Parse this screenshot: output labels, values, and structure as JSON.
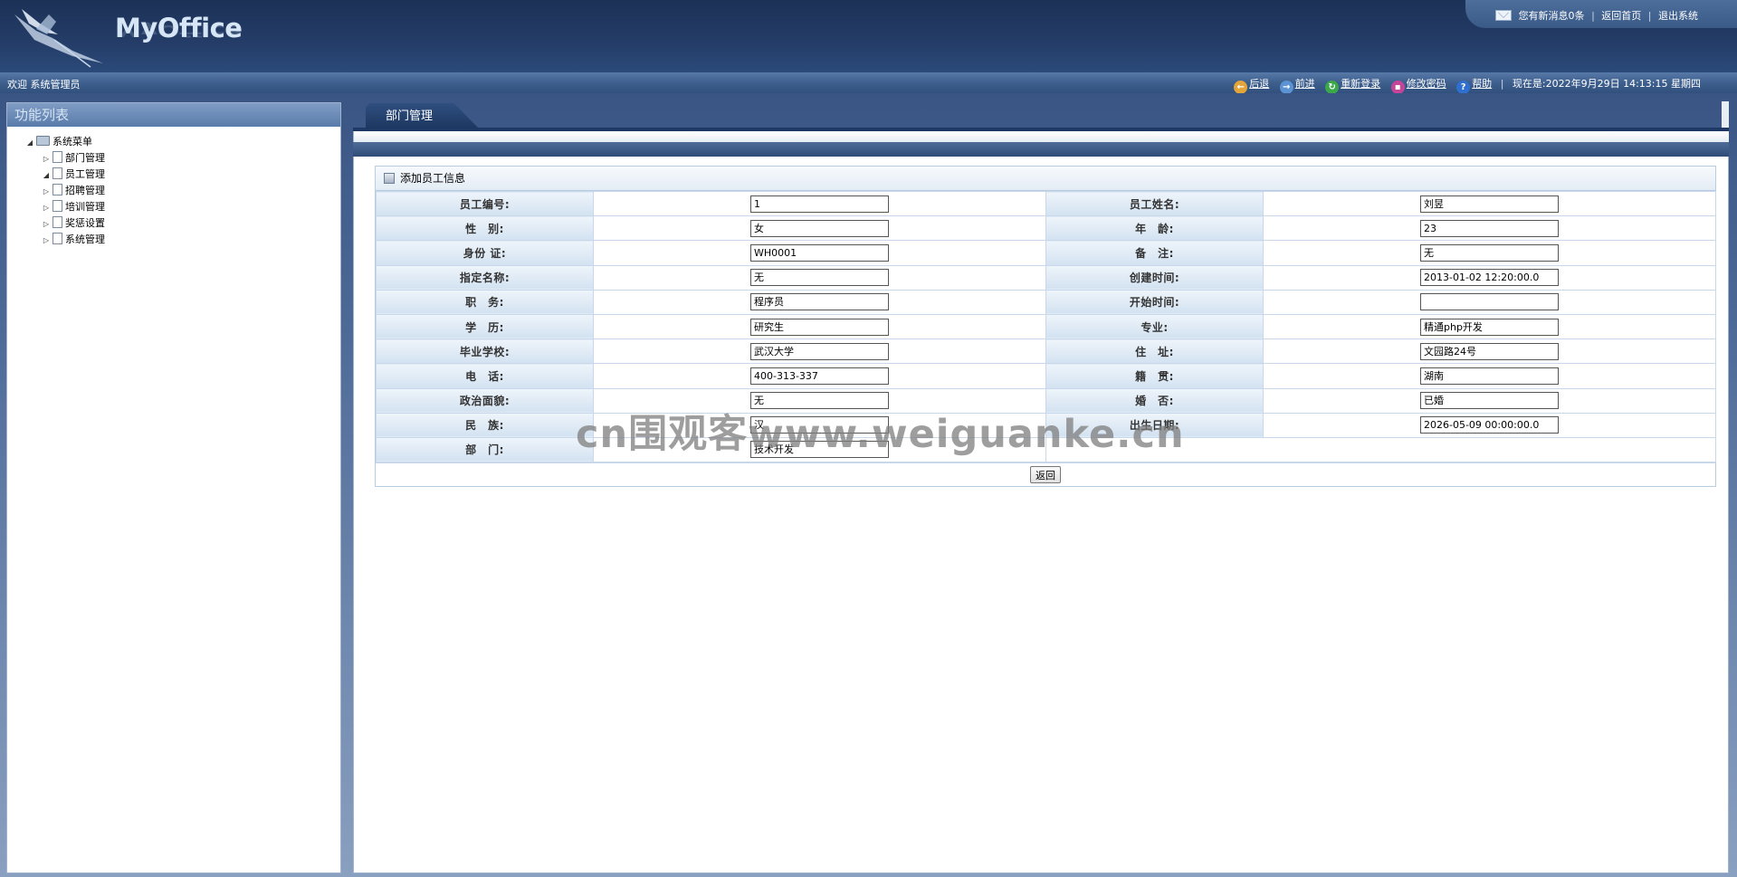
{
  "header": {
    "logo_text": "MyOffice",
    "top_links": {
      "messages": "您有新消息0条",
      "home": "返回首页",
      "logout": "退出系统",
      "separator": "|"
    }
  },
  "subbar": {
    "welcome": "欢迎 系统管理员",
    "nav": [
      {
        "label": "后退",
        "icon": "back-arrow-icon",
        "color": "#e3a43a"
      },
      {
        "label": "前进",
        "icon": "forward-arrow-icon",
        "color": "#5b93d3"
      },
      {
        "label": "重新登录",
        "icon": "relogin-icon",
        "color": "#3aa84a"
      },
      {
        "label": "修改密码",
        "icon": "lock-icon",
        "color": "#c4449a"
      },
      {
        "label": "帮助",
        "icon": "help-icon",
        "color": "#2f6fcf"
      }
    ],
    "datetime": "现在是:2022年9月29日 14:13:15 星期四"
  },
  "sidebar": {
    "title": "功能列表",
    "root": "系统菜单",
    "items": [
      {
        "label": "部门管理",
        "expanded": false
      },
      {
        "label": "员工管理",
        "expanded": true
      },
      {
        "label": "招聘管理",
        "expanded": false
      },
      {
        "label": "培训管理",
        "expanded": false
      },
      {
        "label": "奖惩设置",
        "expanded": false
      },
      {
        "label": "系统管理",
        "expanded": false
      }
    ]
  },
  "main": {
    "tab": "部门管理",
    "form_title": "添加员工信息",
    "fields": {
      "emp_no_label": "员工编号:",
      "emp_no": "1",
      "emp_name_label": "员工姓名:",
      "emp_name": "刘昱",
      "gender_label": "性　别:",
      "gender": "女",
      "age_label": "年　龄:",
      "age": "23",
      "id_label": "身份 证:",
      "id": "WH0001",
      "remark_label": "备　注:",
      "remark": "无",
      "designation_label": "指定名称:",
      "designation": "无",
      "created_label": "创建时间:",
      "created": "2013-01-02 12:20:00.0",
      "position_label": "职　务:",
      "position": "程序员",
      "start_label": "开始时间:",
      "start": "",
      "education_label": "学　历:",
      "education": "研究生",
      "major_label": "专业:",
      "major": "精通php开发",
      "school_label": "毕业学校:",
      "school": "武汉大学",
      "address_label": "住　址:",
      "address": "文园路24号",
      "phone_label": "电　话:",
      "phone": "400-313-337",
      "origin_label": "籍　贯:",
      "origin": "湖南",
      "politics_label": "政治面貌:",
      "politics": "无",
      "marital_label": "婚　否:",
      "marital": "已婚",
      "ethnic_label": "民　族:",
      "ethnic": "汉",
      "birth_label": "出生日期:",
      "birth": "2026-05-09 00:00:00.0",
      "dept_label": "部　门:",
      "dept": "技术开发"
    },
    "back_button": "返回"
  },
  "watermark": "cn围观客www.weiguanke.cn"
}
